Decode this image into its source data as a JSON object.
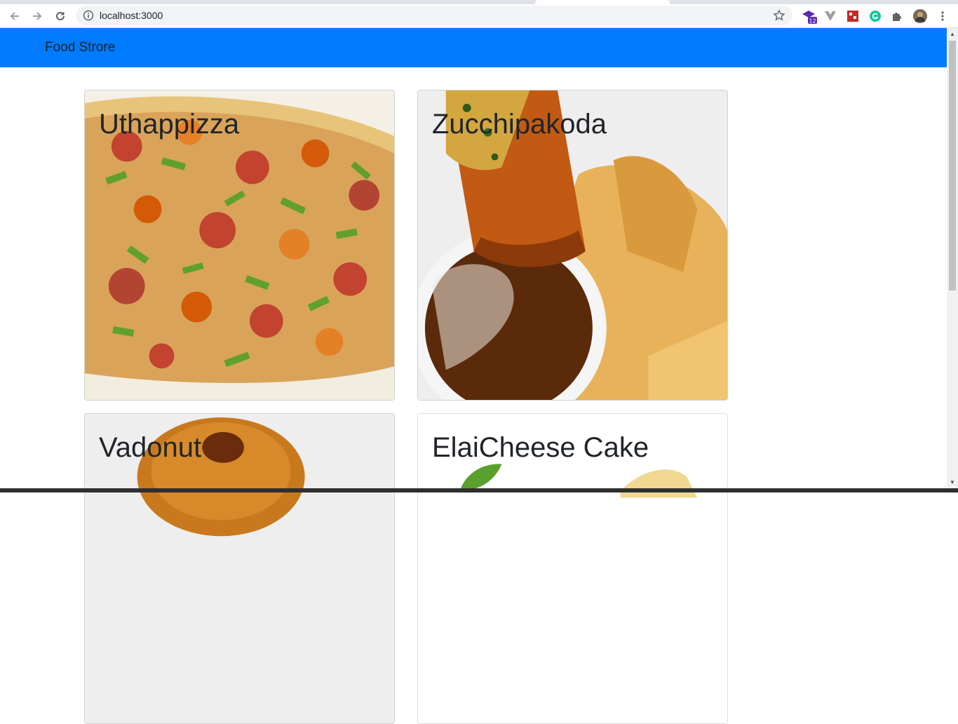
{
  "browser": {
    "url": "localhost:3000",
    "extension_badge": "12"
  },
  "navbar": {
    "brand": "Food Strore"
  },
  "dishes": [
    {
      "name": "Uthappizza"
    },
    {
      "name": "Zucchipakoda"
    },
    {
      "name": "Vadonut"
    },
    {
      "name": "ElaiCheese Cake"
    }
  ],
  "colors": {
    "navbar": "#007bff",
    "title_text": "#212529"
  },
  "icons": [
    "back-icon",
    "forward-icon",
    "reload-icon",
    "info-icon",
    "star-icon",
    "extension-icons",
    "puzzle-icon",
    "profile-avatar",
    "menu-icon"
  ]
}
